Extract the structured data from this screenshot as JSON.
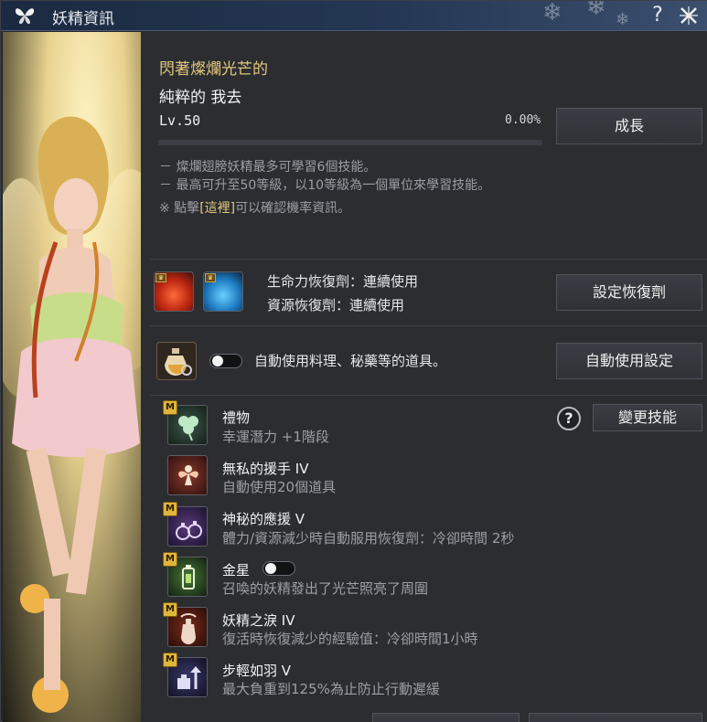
{
  "window": {
    "title": "妖精資訊",
    "help_icon": "?",
    "icons": {
      "title": "butterfly-icon",
      "close": "close-snowflake-icon"
    }
  },
  "fairy": {
    "name_line1": "閃著燦爛光芒的",
    "name_line2": "純粹的 我去",
    "level": "Lv.50",
    "exp_percent": "0.00%",
    "exp_value": 0,
    "grow_button": "成長",
    "notes": [
      "－ 燦爛翅膀妖精最多可學習6個技能。",
      "－ 最高可升至50等級，以10等級為一個單位來學習技能。"
    ],
    "note3_prefix": "※ 點擊",
    "note3_link": "[這裡]",
    "note3_suffix": "可以確認機率資訊。"
  },
  "potions": {
    "hp_text": "生命力恢復劑：連續使用",
    "mp_text": "資源恢復劑：連續使用",
    "button": "設定恢復劑",
    "colors": {
      "hp": "#d23a1f",
      "mp": "#2a8fd6"
    }
  },
  "auto_use": {
    "text": "自動使用料理、秘藥等的道具。",
    "button": "自動使用設定",
    "enabled": false
  },
  "skills_panel": {
    "change_button": "變更技能",
    "help_icon": "?",
    "badge": "M",
    "skills": [
      {
        "name": "禮物",
        "desc": "幸運潛力 +1階段",
        "icon": "clover-icon",
        "badge": true
      },
      {
        "name": "無私的援手 IV",
        "desc": "自動使用20個道具",
        "icon": "fairy-icon",
        "badge": false
      },
      {
        "name": "神秘的應援 V",
        "desc": "體力/資源減少時自動服用恢復劑：冷卻時間 2秒",
        "icon": "potion-bottles-icon",
        "badge": true
      },
      {
        "name": "金星",
        "desc": "召喚的妖精發出了光芒照亮了周圍",
        "icon": "lantern-icon",
        "badge": true,
        "has_toggle": true,
        "toggle_on": false
      },
      {
        "name": "妖精之淚 IV",
        "desc": "復活時恢復減少的經驗值：冷卻時間1小時",
        "icon": "tear-vial-icon",
        "badge": true
      },
      {
        "name": "步輕如羽 V",
        "desc": "最大負重到125%為止防止行動遲緩",
        "icon": "weight-arrow-icon",
        "badge": true
      }
    ]
  },
  "colors": {
    "gold": "#e4c77a",
    "panel": "#2b2d31",
    "title_bar": "#243754"
  }
}
